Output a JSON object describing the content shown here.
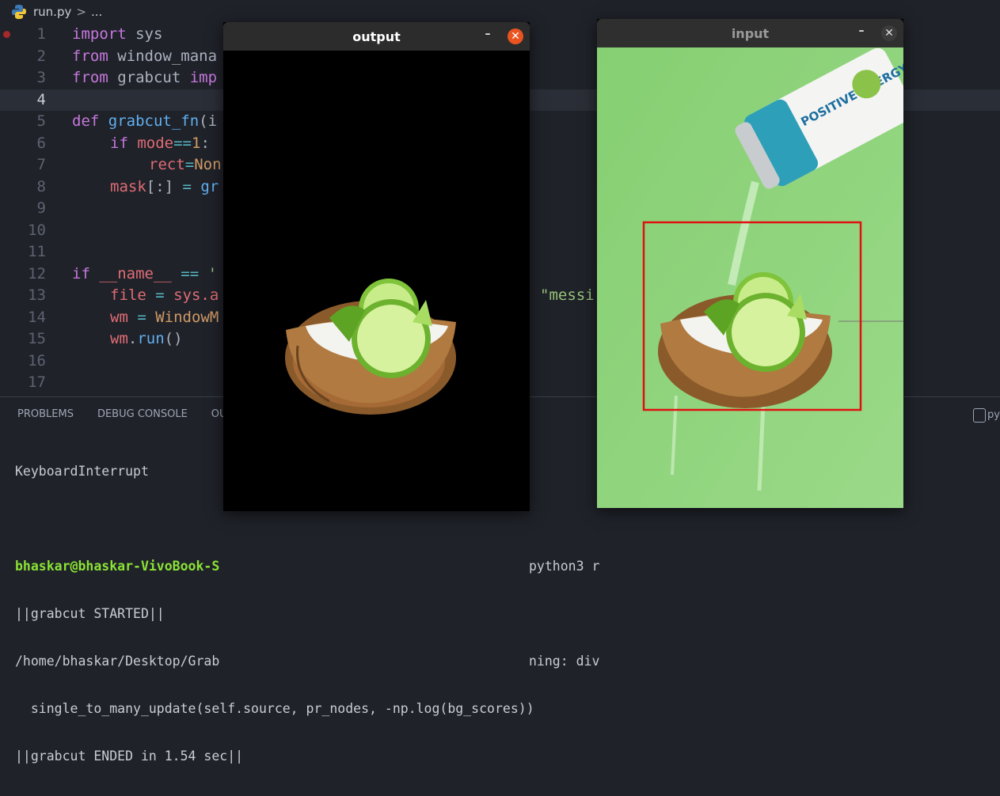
{
  "breadcrumb": {
    "file": "run.py",
    "separator": ">",
    "rest": "..."
  },
  "editor": {
    "line_numbers": [
      "1",
      "2",
      "3",
      "4",
      "5",
      "6",
      "7",
      "8",
      "9",
      "10",
      "11",
      "12",
      "13",
      "14",
      "15",
      "16",
      "17"
    ],
    "lines": {
      "l1_kw": "import",
      "l1_rest": " sys",
      "l2_kw": "from",
      "l2_rest": " window_mana",
      "l3_kw": "from",
      "l3_rest": " grabcut ",
      "l3_kw2": "imp",
      "l5_kw": "def",
      "l5_fn": " grabcut_fn",
      "l5_rest": "(i",
      "l6_kw": "if",
      "l6_var": " mode",
      "l6_op": "==",
      "l6_num": "1",
      "l6_rest": ":",
      "l7_var": "rect",
      "l7_op": "=",
      "l7_num": "Non",
      "l8_var": "mask",
      "l8_rest": "[:] ",
      "l8_op": "=",
      "l8_rest2": " gr",
      "l12_kw": "if",
      "l12_rest": " __name__ ",
      "l12_op": "==",
      "l12_str": " '",
      "l13_var": "file",
      "l13_op": " = ",
      "l13_rest": "sys.a",
      "l13_str": "\"messi",
      "l14_var": "wm",
      "l14_op": " = ",
      "l14_fn": "WindowM",
      "l15_var": "wm",
      "l15_rest": ".",
      "l15_fn": "run",
      "l15_rest2": "()"
    }
  },
  "panel": {
    "tabs": [
      "PROBLEMS",
      "DEBUG CONSOLE",
      "OU"
    ],
    "right_label": "py",
    "terminal": {
      "line1": "KeyboardInterrupt",
      "prompt": "bhaskar@bhaskar-VivoBook-S",
      "prompt_tail": "python3 r",
      "line3": "||grabcut STARTED||",
      "line4": "/home/bhaskar/Desktop/Grab",
      "line4_tail": "ning: div",
      "line5": "  single_to_many_update(self.source, pr_nodes, -np.log(bg_scores))",
      "line6": "||grabcut ENDED in 1.54 sec||"
    }
  },
  "windows": {
    "output": {
      "title": "output",
      "minimize": "–",
      "close": "✕"
    },
    "input": {
      "title": "input",
      "minimize": "–",
      "close": "✕",
      "can_text": "POSITIVE ENERGY"
    }
  },
  "colors": {
    "accent_close": "#e95420",
    "selection_rect": "#e01010",
    "green_bg": "#8fd37a"
  }
}
